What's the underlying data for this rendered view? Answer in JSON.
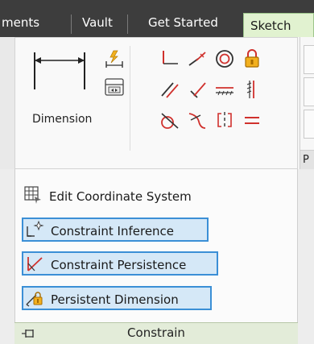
{
  "tabs": [
    {
      "label": "ments"
    },
    {
      "label": "Vault"
    },
    {
      "label": "Get Started"
    },
    {
      "label": "Sketch",
      "active": true
    }
  ],
  "panel": {
    "dimension_label": "Dimension",
    "adjacent_footer_fragment": "P"
  },
  "menu": {
    "items": [
      {
        "label": "Edit Coordinate System",
        "checked": false,
        "icon": "grid-coordinate-icon"
      },
      {
        "label": "Constraint Inference",
        "checked": true,
        "icon": "constraint-inference-icon"
      },
      {
        "label": "Constraint Persistence",
        "checked": true,
        "icon": "constraint-persistence-icon"
      },
      {
        "label": "Persistent Dimension",
        "checked": true,
        "icon": "persistent-dimension-icon"
      }
    ]
  },
  "footer": {
    "title": "Constrain"
  },
  "colors": {
    "accent_checked_border": "#3b8fd6",
    "accent_checked_fill": "#d5e8f7",
    "active_tab": "#e1f2d0",
    "constraint_red": "#d0312d",
    "tabbar_bg": "#3d3d3d"
  }
}
